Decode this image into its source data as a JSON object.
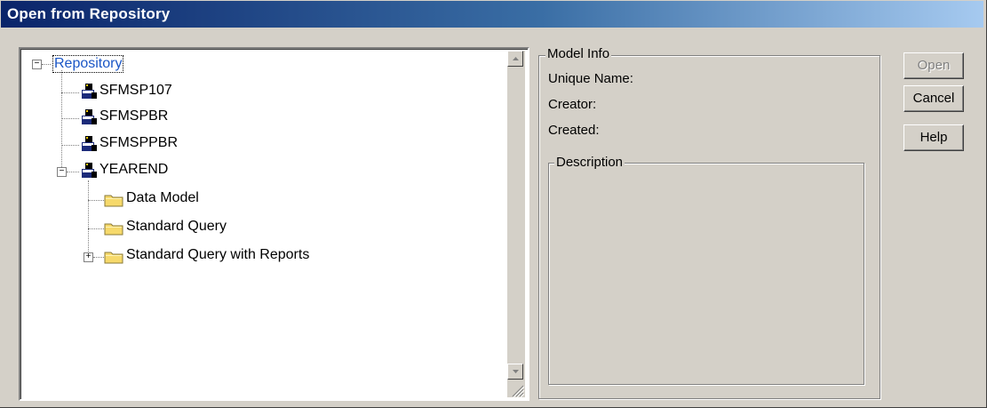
{
  "window": {
    "title": "Open from Repository"
  },
  "tree": {
    "root": {
      "label": "Repository",
      "expanded": true
    },
    "items": [
      {
        "label": "SFMSP107",
        "icon": "database-icon"
      },
      {
        "label": "SFMSPBR",
        "icon": "database-icon"
      },
      {
        "label": "SFMSPPBR",
        "icon": "database-icon"
      },
      {
        "label": "YEAREND",
        "icon": "database-icon",
        "expanded": true,
        "children": [
          {
            "label": "Data Model",
            "icon": "folder-icon"
          },
          {
            "label": "Standard Query",
            "icon": "folder-icon"
          },
          {
            "label": "Standard Query with Reports",
            "icon": "folder-icon",
            "expandable": true
          }
        ]
      }
    ]
  },
  "model_info": {
    "legend": "Model Info",
    "unique_name_label": "Unique Name:",
    "creator_label": "Creator:",
    "created_label": "Created:",
    "description_legend": "Description"
  },
  "buttons": {
    "open": "Open",
    "cancel": "Cancel",
    "help": "Help"
  },
  "colors": {
    "title_start": "#0a246a",
    "title_end": "#a6caf0",
    "dialog_face": "#d4d0c8",
    "selection_text": "#1a56c6"
  }
}
